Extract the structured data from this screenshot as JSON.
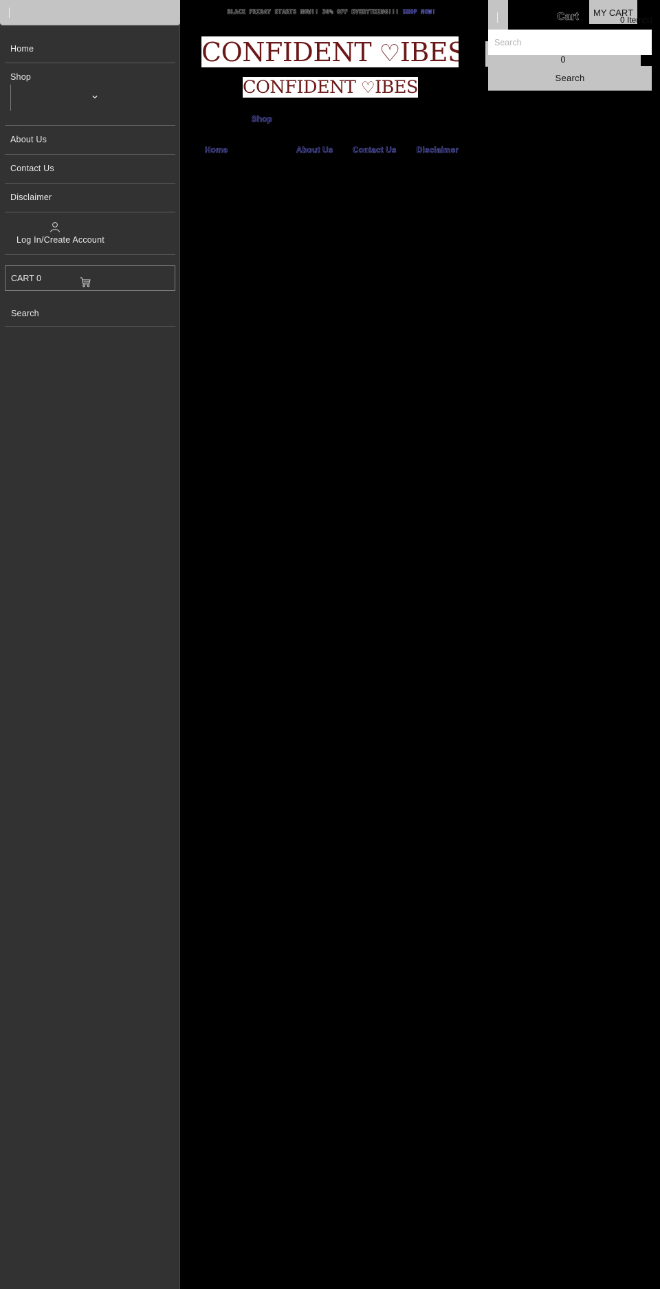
{
  "sidebar": {
    "items": [
      {
        "label": "Home"
      },
      {
        "label": "Shop"
      },
      {
        "label": "About Us"
      },
      {
        "label": "Contact Us"
      },
      {
        "label": "Disclaimer"
      },
      {
        "label": "Log In/Create Account"
      }
    ],
    "shop_select_value": "",
    "cart_label": "CART 0",
    "search_label": "Search"
  },
  "header": {
    "announcement": {
      "text": "BLACK FRIDAY STARTS NOW!! 30% OFF EVERYTHING!!! ",
      "link_label": "SHOP NOW!"
    },
    "logo_large": {
      "text_before": "CONFIDENT ",
      "heart": "♡",
      "text_after": "IBES"
    },
    "logo_small": {
      "text_before": "CONFIDENT ",
      "heart": "♡",
      "text_after": "IBES"
    },
    "nav": {
      "shop": "Shop",
      "home": "Home",
      "about": "About Us",
      "contact": "Contact Us",
      "disclaimer": "Disclaimer"
    }
  },
  "cart_panel": {
    "cart_ghost_label": "Cart",
    "my_cart_label": "MY CART",
    "item_count": "0 Item(s)",
    "search_placeholder": "Search",
    "search_value": "",
    "count_value": "0",
    "search_button_label": "Search"
  },
  "colors": {
    "sidebar_bg": "#323232",
    "page_bg": "#000000",
    "button_gray": "#c4c4c4",
    "logo_text": "#6b1818",
    "link_accent": "#8b8bef"
  }
}
